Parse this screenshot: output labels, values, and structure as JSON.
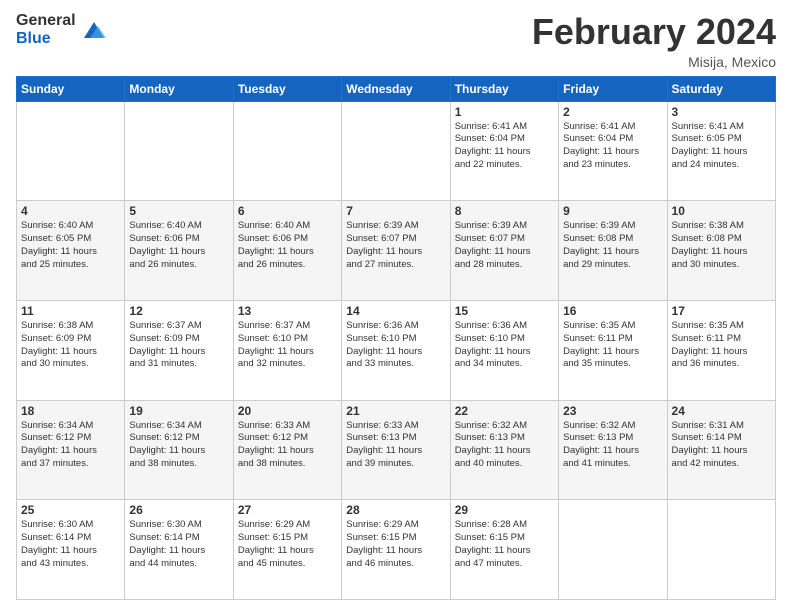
{
  "logo": {
    "general": "General",
    "blue": "Blue"
  },
  "header": {
    "month": "February 2024",
    "location": "Misija, Mexico"
  },
  "days_of_week": [
    "Sunday",
    "Monday",
    "Tuesday",
    "Wednesday",
    "Thursday",
    "Friday",
    "Saturday"
  ],
  "weeks": [
    [
      {
        "day": "",
        "info": ""
      },
      {
        "day": "",
        "info": ""
      },
      {
        "day": "",
        "info": ""
      },
      {
        "day": "",
        "info": ""
      },
      {
        "day": "1",
        "info": "Sunrise: 6:41 AM\nSunset: 6:04 PM\nDaylight: 11 hours\nand 22 minutes."
      },
      {
        "day": "2",
        "info": "Sunrise: 6:41 AM\nSunset: 6:04 PM\nDaylight: 11 hours\nand 23 minutes."
      },
      {
        "day": "3",
        "info": "Sunrise: 6:41 AM\nSunset: 6:05 PM\nDaylight: 11 hours\nand 24 minutes."
      }
    ],
    [
      {
        "day": "4",
        "info": "Sunrise: 6:40 AM\nSunset: 6:05 PM\nDaylight: 11 hours\nand 25 minutes."
      },
      {
        "day": "5",
        "info": "Sunrise: 6:40 AM\nSunset: 6:06 PM\nDaylight: 11 hours\nand 26 minutes."
      },
      {
        "day": "6",
        "info": "Sunrise: 6:40 AM\nSunset: 6:06 PM\nDaylight: 11 hours\nand 26 minutes."
      },
      {
        "day": "7",
        "info": "Sunrise: 6:39 AM\nSunset: 6:07 PM\nDaylight: 11 hours\nand 27 minutes."
      },
      {
        "day": "8",
        "info": "Sunrise: 6:39 AM\nSunset: 6:07 PM\nDaylight: 11 hours\nand 28 minutes."
      },
      {
        "day": "9",
        "info": "Sunrise: 6:39 AM\nSunset: 6:08 PM\nDaylight: 11 hours\nand 29 minutes."
      },
      {
        "day": "10",
        "info": "Sunrise: 6:38 AM\nSunset: 6:08 PM\nDaylight: 11 hours\nand 30 minutes."
      }
    ],
    [
      {
        "day": "11",
        "info": "Sunrise: 6:38 AM\nSunset: 6:09 PM\nDaylight: 11 hours\nand 30 minutes."
      },
      {
        "day": "12",
        "info": "Sunrise: 6:37 AM\nSunset: 6:09 PM\nDaylight: 11 hours\nand 31 minutes."
      },
      {
        "day": "13",
        "info": "Sunrise: 6:37 AM\nSunset: 6:10 PM\nDaylight: 11 hours\nand 32 minutes."
      },
      {
        "day": "14",
        "info": "Sunrise: 6:36 AM\nSunset: 6:10 PM\nDaylight: 11 hours\nand 33 minutes."
      },
      {
        "day": "15",
        "info": "Sunrise: 6:36 AM\nSunset: 6:10 PM\nDaylight: 11 hours\nand 34 minutes."
      },
      {
        "day": "16",
        "info": "Sunrise: 6:35 AM\nSunset: 6:11 PM\nDaylight: 11 hours\nand 35 minutes."
      },
      {
        "day": "17",
        "info": "Sunrise: 6:35 AM\nSunset: 6:11 PM\nDaylight: 11 hours\nand 36 minutes."
      }
    ],
    [
      {
        "day": "18",
        "info": "Sunrise: 6:34 AM\nSunset: 6:12 PM\nDaylight: 11 hours\nand 37 minutes."
      },
      {
        "day": "19",
        "info": "Sunrise: 6:34 AM\nSunset: 6:12 PM\nDaylight: 11 hours\nand 38 minutes."
      },
      {
        "day": "20",
        "info": "Sunrise: 6:33 AM\nSunset: 6:12 PM\nDaylight: 11 hours\nand 38 minutes."
      },
      {
        "day": "21",
        "info": "Sunrise: 6:33 AM\nSunset: 6:13 PM\nDaylight: 11 hours\nand 39 minutes."
      },
      {
        "day": "22",
        "info": "Sunrise: 6:32 AM\nSunset: 6:13 PM\nDaylight: 11 hours\nand 40 minutes."
      },
      {
        "day": "23",
        "info": "Sunrise: 6:32 AM\nSunset: 6:13 PM\nDaylight: 11 hours\nand 41 minutes."
      },
      {
        "day": "24",
        "info": "Sunrise: 6:31 AM\nSunset: 6:14 PM\nDaylight: 11 hours\nand 42 minutes."
      }
    ],
    [
      {
        "day": "25",
        "info": "Sunrise: 6:30 AM\nSunset: 6:14 PM\nDaylight: 11 hours\nand 43 minutes."
      },
      {
        "day": "26",
        "info": "Sunrise: 6:30 AM\nSunset: 6:14 PM\nDaylight: 11 hours\nand 44 minutes."
      },
      {
        "day": "27",
        "info": "Sunrise: 6:29 AM\nSunset: 6:15 PM\nDaylight: 11 hours\nand 45 minutes."
      },
      {
        "day": "28",
        "info": "Sunrise: 6:29 AM\nSunset: 6:15 PM\nDaylight: 11 hours\nand 46 minutes."
      },
      {
        "day": "29",
        "info": "Sunrise: 6:28 AM\nSunset: 6:15 PM\nDaylight: 11 hours\nand 47 minutes."
      },
      {
        "day": "",
        "info": ""
      },
      {
        "day": "",
        "info": ""
      }
    ]
  ]
}
